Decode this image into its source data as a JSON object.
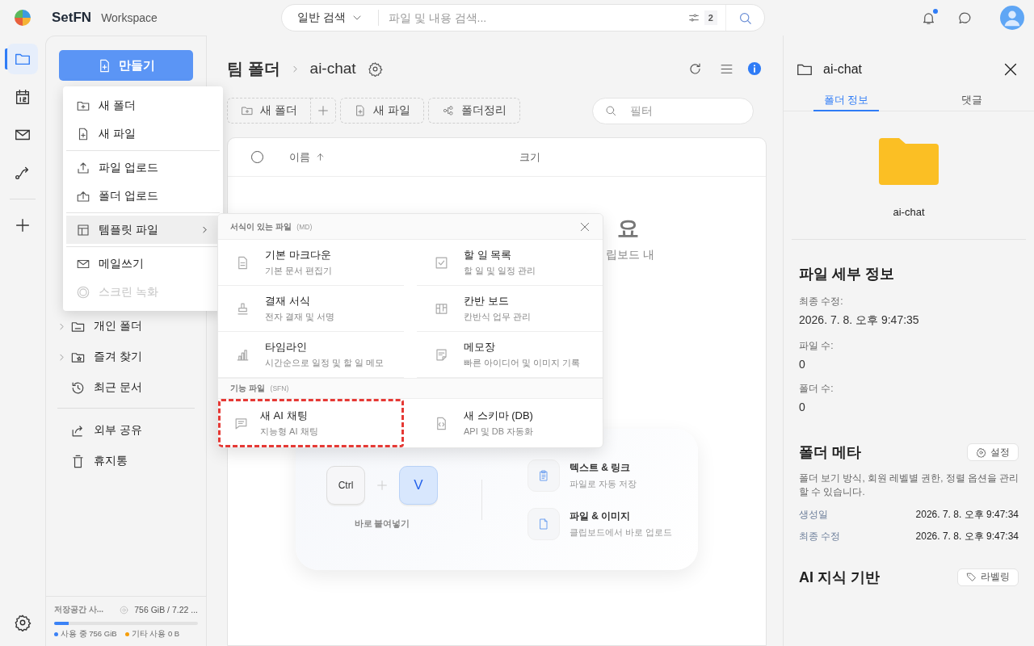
{
  "app": {
    "name": "SetFN",
    "subtitle": "Workspace"
  },
  "search": {
    "mode": "일반 검색",
    "placeholder": "파일 및 내용 검색...",
    "filter_count": "2"
  },
  "notifications": {
    "unread": true
  },
  "rail_items": [
    {
      "selected": true
    },
    {
      "selected": false
    },
    {
      "selected": false
    },
    {
      "selected": false
    }
  ],
  "create_button": "만들기",
  "sidebar": {
    "items": [
      {
        "label": "개인 폴더",
        "has_children": true
      },
      {
        "label": "즐겨 찾기",
        "has_children": true
      },
      {
        "label": "최근 문서",
        "has_children": false
      },
      {
        "label": "외부 공유",
        "has_children": false
      },
      {
        "label": "휴지통",
        "has_children": false
      }
    ]
  },
  "storage": {
    "label": "저장공간 사...",
    "total": "756 GiB / 7.22 ...",
    "level": 0.1,
    "legend": [
      {
        "label": "사용 중 756 GiB",
        "color": "#3b82f6"
      },
      {
        "label": "기타 사용 0 B",
        "color": "#f59e0b"
      }
    ]
  },
  "breadcrumb": [
    "팀 폴더",
    "ai-chat"
  ],
  "toolbar": {
    "buttons": [
      "새 폴더",
      "새 파일",
      "폴더정리"
    ],
    "filter_placeholder": "필터"
  },
  "table": {
    "select_all": {
      "checked": false
    },
    "columns": [
      {
        "label": "이름",
        "sorted": true
      },
      {
        "label": "크기",
        "sorted": false
      }
    ]
  },
  "empty_state": {
    "title": "요",
    "subtitle": "립보드 내",
    "keys": [
      "Ctrl",
      "V"
    ],
    "caption": "바로 붙여넣기",
    "features": [
      {
        "title": "텍스트 & 링크",
        "subtitle": "파일로 자동 저장"
      },
      {
        "title": "파일 & 이미지",
        "subtitle": "클립보드에서 바로 업로드"
      }
    ]
  },
  "create_menu": {
    "items": [
      {
        "kind": "item",
        "label": "새 폴더",
        "selected": false,
        "disabled": false
      },
      {
        "kind": "item",
        "label": "새 파일",
        "selected": false,
        "disabled": false
      },
      {
        "kind": "divider"
      },
      {
        "kind": "item",
        "label": "파일 업로드",
        "selected": false,
        "disabled": false
      },
      {
        "kind": "item",
        "label": "폴더 업로드",
        "selected": false,
        "disabled": false
      },
      {
        "kind": "divider"
      },
      {
        "kind": "submenu",
        "label": "템플릿 파일",
        "selected": true,
        "disabled": false
      },
      {
        "kind": "divider"
      },
      {
        "kind": "item",
        "label": "메일쓰기",
        "selected": false,
        "disabled": false
      },
      {
        "kind": "item",
        "label": "스크린 녹화",
        "selected": false,
        "disabled": true
      }
    ]
  },
  "template_menu": {
    "sections": [
      {
        "title": "서식이 있는 파일",
        "tag": "(MD)",
        "items": [
          {
            "title": "기본 마크다운",
            "subtitle": "기본 문서 편집기",
            "highlighted": false
          },
          {
            "title": "할 일 목록",
            "subtitle": "할 일 및 일정 관리",
            "highlighted": false
          },
          {
            "title": "결재 서식",
            "subtitle": "전자 결재 및 서명",
            "highlighted": false
          },
          {
            "title": "칸반 보드",
            "subtitle": "칸반식 업무 관리",
            "highlighted": false
          },
          {
            "title": "타임라인",
            "subtitle": "시간순으로 일정 및 할 일 메모",
            "highlighted": false
          },
          {
            "title": "메모장",
            "subtitle": "빠른 아이디어 및 이미지 기록",
            "highlighted": false
          }
        ]
      },
      {
        "title": "기능 파일",
        "tag": "(SFN)",
        "items": [
          {
            "title": "새 AI 채팅",
            "subtitle": "지능형 AI 채팅",
            "highlighted": true
          },
          {
            "title": "새 스키마 (DB)",
            "subtitle": "API 및 DB 자동화",
            "highlighted": false
          }
        ]
      }
    ]
  },
  "details_panel": {
    "title": "ai-chat",
    "tabs": [
      {
        "label": "폴더 정보",
        "selected": true
      },
      {
        "label": "댓글",
        "selected": false
      }
    ],
    "folder_name": "ai-chat",
    "file_details": {
      "title": "파일 세부 정보",
      "fields": [
        {
          "label": "최종 수정:",
          "value": "2026. 7. 8. 오후 9:47:35"
        },
        {
          "label": "파일 수:",
          "value": "0"
        },
        {
          "label": "폴더 수:",
          "value": "0"
        }
      ]
    },
    "folder_meta": {
      "title": "폴더 메타",
      "button": "설정",
      "description": "폴더 보기 방식, 회원 레벨별 권한, 정렬 옵션을 관리할 수 있습니다.",
      "rows": [
        {
          "label": "생성일",
          "value": "2026. 7. 8. 오후 9:47:34"
        },
        {
          "label": "최종 수정",
          "value": "2026. 7. 8. 오후 9:47:34"
        }
      ]
    },
    "ai_knowledge": {
      "title": "AI 지식 기반",
      "button": "라벨링"
    }
  }
}
